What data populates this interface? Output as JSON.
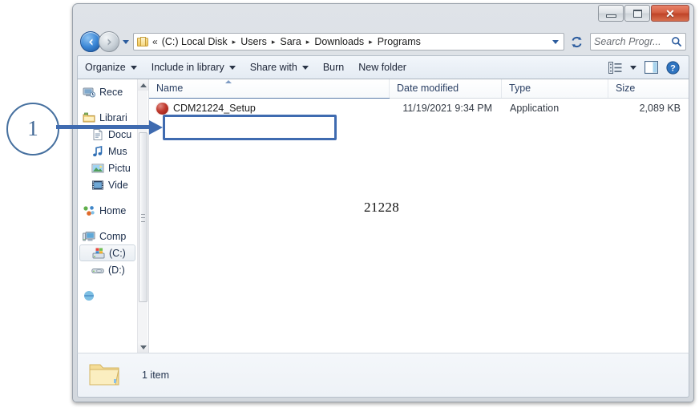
{
  "window": {
    "buttons": {
      "minimize": "minimize",
      "maximize": "maximize",
      "close": "✕"
    }
  },
  "address": {
    "chevrons": "«",
    "crumbs": [
      "(C:) Local Disk",
      "Users",
      "Sara",
      "Downloads",
      "Programs"
    ],
    "separator": "▸",
    "folder_icon": "folder-icon",
    "dropdown_icon": "chevron-down-icon",
    "refresh_icon": "refresh-icon"
  },
  "search": {
    "placeholder": "Search Progr...",
    "icon": "search-icon"
  },
  "toolbar": {
    "items": [
      {
        "label": "Organize",
        "caret": true
      },
      {
        "label": "Include in library",
        "caret": true
      },
      {
        "label": "Share with",
        "caret": true
      },
      {
        "label": "Burn",
        "caret": false
      },
      {
        "label": "New folder",
        "caret": false
      }
    ],
    "view_icon": "view-list-icon",
    "view_caret": "chevron-down-icon",
    "preview_icon": "preview-pane-icon",
    "help_icon": "help-icon"
  },
  "nav_pane": {
    "items": [
      {
        "label": "Rece",
        "icon": "recent-places-icon",
        "indent": false,
        "selected": false
      },
      {
        "label": "Librari",
        "icon": "libraries-icon",
        "indent": false,
        "selected": false
      },
      {
        "label": "Docu",
        "icon": "documents-icon",
        "indent": true,
        "selected": false
      },
      {
        "label": "Mus",
        "icon": "music-icon",
        "indent": true,
        "selected": false
      },
      {
        "label": "Pictu",
        "icon": "pictures-icon",
        "indent": true,
        "selected": false
      },
      {
        "label": "Vide",
        "icon": "videos-icon",
        "indent": true,
        "selected": false
      },
      {
        "label": "Home",
        "icon": "homegroup-icon",
        "indent": false,
        "selected": false
      },
      {
        "label": "Comp",
        "icon": "computer-icon",
        "indent": false,
        "selected": false
      },
      {
        "label": "(C:)",
        "icon": "local-disk-icon",
        "indent": true,
        "selected": true
      },
      {
        "label": "(D:)",
        "icon": "dvd-drive-icon",
        "indent": true,
        "selected": false
      }
    ]
  },
  "columns": [
    {
      "key": "name",
      "label": "Name"
    },
    {
      "key": "date",
      "label": "Date modified"
    },
    {
      "key": "type",
      "label": "Type"
    },
    {
      "key": "size",
      "label": "Size"
    }
  ],
  "files": [
    {
      "name": "CDM21224_Setup",
      "date": "11/19/2021 9:34 PM",
      "type": "Application",
      "size": "2,089 KB",
      "icon": "application-icon"
    }
  ],
  "status": {
    "text": "1 item",
    "folder_icon": "folder-icon"
  },
  "artifacts": {
    "stray_number": "21228"
  },
  "annotation": {
    "number": "1",
    "color": "#3f6bb0",
    "circle_color": "#46709f"
  }
}
